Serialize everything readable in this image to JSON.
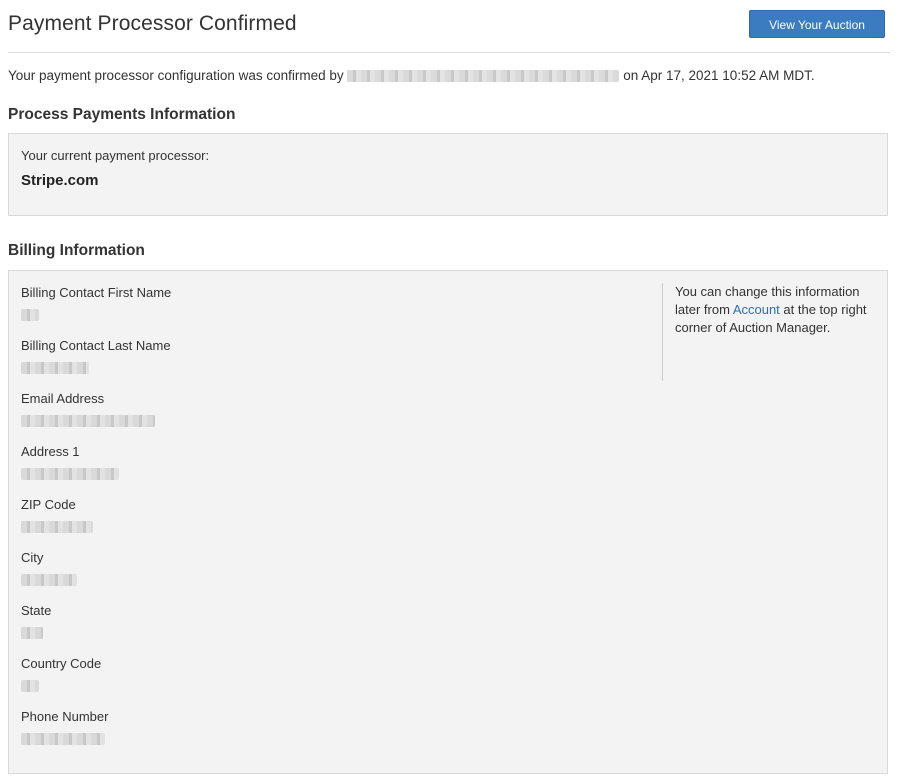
{
  "header": {
    "title": "Payment Processor Confirmed",
    "view_auction_label": "View Your Auction"
  },
  "confirmation": {
    "prefix": "Your payment processor configuration was confirmed by",
    "suffix": "on Apr 17, 2021 10:52 AM MDT."
  },
  "process_payments": {
    "section_title": "Process Payments Information",
    "current_label": "Your current payment processor:",
    "current_value": "Stripe.com"
  },
  "billing": {
    "section_title": "Billing Information",
    "fields": [
      {
        "label": "Billing Contact First Name"
      },
      {
        "label": "Billing Contact Last Name"
      },
      {
        "label": "Email Address"
      },
      {
        "label": "Address 1"
      },
      {
        "label": "ZIP Code"
      },
      {
        "label": "City"
      },
      {
        "label": "State"
      },
      {
        "label": "Country Code"
      },
      {
        "label": "Phone Number"
      }
    ],
    "note_before": "You can change this information later from",
    "note_link": "Account",
    "note_after": "at the top right corner of Auction Manager."
  },
  "colors": {
    "accent": "#3b7bbf",
    "link": "#2f6fb3",
    "panel_bg": "#f3f3f3"
  }
}
